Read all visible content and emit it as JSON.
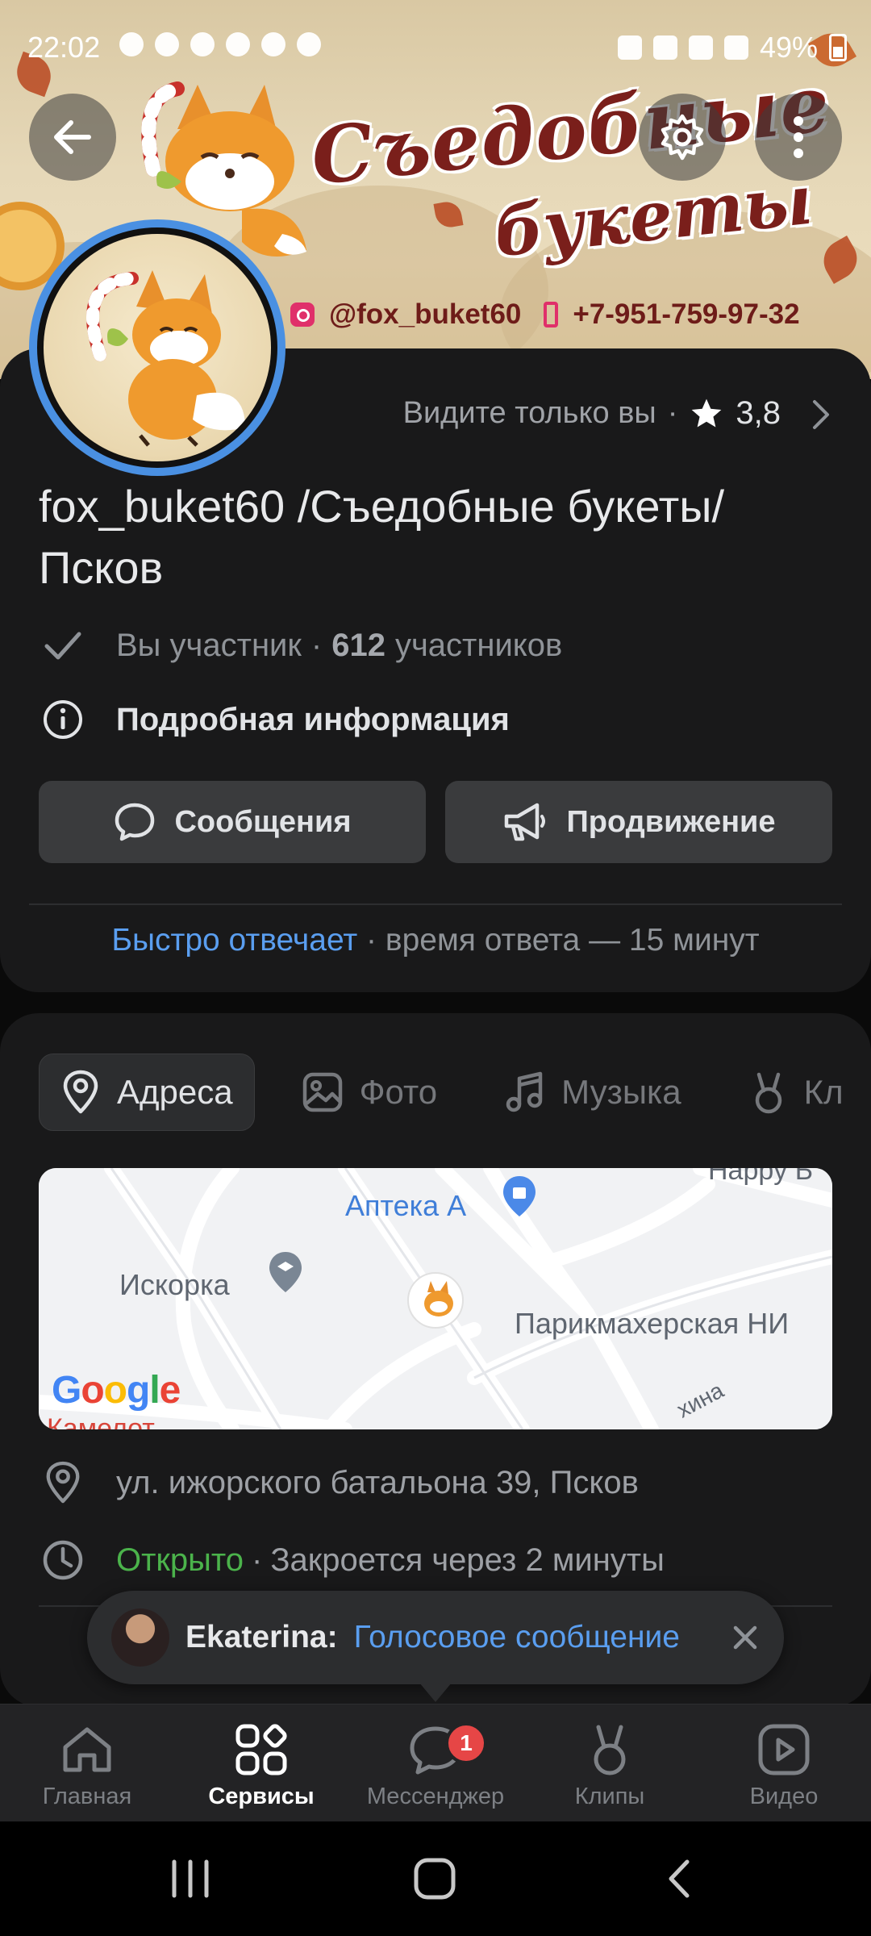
{
  "status_bar": {
    "time": "22:02",
    "battery": "49%"
  },
  "cover": {
    "brand_line1": "Съедобные",
    "brand_line2": "букеты",
    "instagram": "@fox_buket60",
    "phone": "+7-951-759-97-32"
  },
  "header": {
    "back_icon": "arrow-left-icon",
    "settings_icon": "gear-icon",
    "more_icon": "dots-vertical-icon"
  },
  "profile": {
    "visibility": "Видите только вы",
    "separator": "·",
    "rating": "3,8",
    "title": "fox_buket60 /Съедобные букеты/ Псков",
    "member_status": "Вы участник",
    "members_count": "612",
    "members_label": "участников",
    "details": "Подробная информация",
    "messages_button": "Сообщения",
    "promo_button": "Продвижение",
    "fast_reply": "Быстро отвечает",
    "reply_time": "время ответа — 15 минут"
  },
  "tabs": [
    {
      "label": "Адреса",
      "icon": "location-pin-icon",
      "active": true
    },
    {
      "label": "Фото",
      "icon": "photo-icon",
      "active": false
    },
    {
      "label": "Музыка",
      "icon": "music-note-icon",
      "active": false
    },
    {
      "label": "Кл",
      "icon": "clips-icon",
      "active": false
    }
  ],
  "map": {
    "labels": [
      "Аптека А",
      "Искорка",
      "Парикмахерская НИ",
      "Happy Б",
      "хина",
      "Камелот"
    ],
    "provider": "Google"
  },
  "address": {
    "street": "ул. ижорского батальона 39, Псков",
    "open": "Открыто",
    "closes": "Закроется через 2 минуты"
  },
  "toast": {
    "name": "Ekaterina:",
    "message": "Голосовое сообщение"
  },
  "nav": {
    "items": [
      {
        "label": "Главная",
        "icon": "home-icon"
      },
      {
        "label": "Сервисы",
        "icon": "services-grid-icon"
      },
      {
        "label": "Мессенджер",
        "icon": "chat-bubble-icon",
        "badge": "1"
      },
      {
        "label": "Клипы",
        "icon": "clips-icon"
      },
      {
        "label": "Видео",
        "icon": "video-icon"
      }
    ],
    "active": "Сервисы"
  },
  "system_nav": [
    "recents-icon",
    "home-circle-icon",
    "back-chevron-icon"
  ]
}
